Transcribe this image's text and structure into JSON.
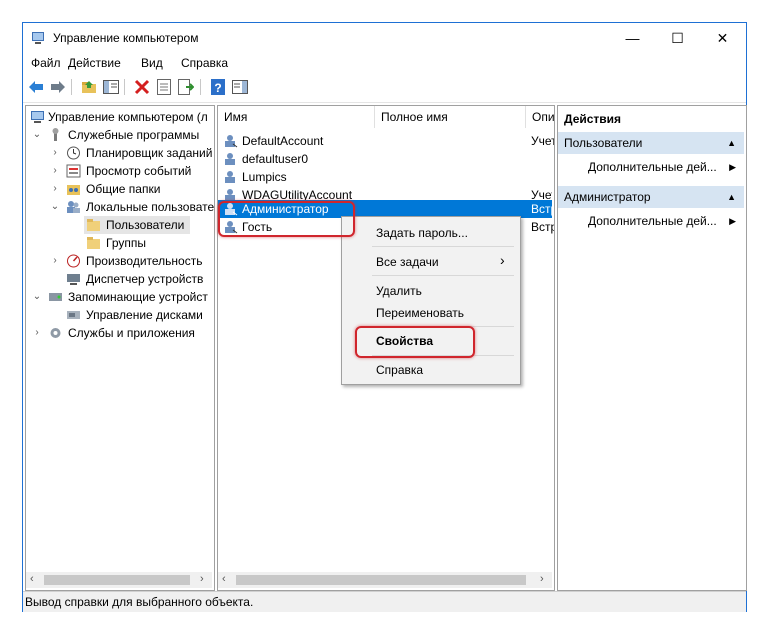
{
  "window": {
    "title": "Управление компьютером"
  },
  "caption": {
    "minimize": "—",
    "maximize": "☐",
    "close": "✕"
  },
  "menu": [
    "Файл",
    "Действие",
    "Вид",
    "Справка"
  ],
  "toolbar": [
    "back-icon",
    "forward-icon",
    "up-folder-icon",
    "show-tree-icon",
    "delete-icon",
    "properties-icon",
    "export-icon",
    "help-icon",
    "action-pane-icon"
  ],
  "tree": {
    "items": [
      {
        "label": "Управление компьютером (л"
      },
      {
        "label": "Служебные программы"
      },
      {
        "label": "Планировщик заданий"
      },
      {
        "label": "Просмотр событий"
      },
      {
        "label": "Общие папки"
      },
      {
        "label": "Локальные пользовате"
      },
      {
        "label": "Пользователи"
      },
      {
        "label": "Группы"
      },
      {
        "label": "Производительность"
      },
      {
        "label": "Диспетчер устройств"
      },
      {
        "label": "Запоминающие устройст"
      },
      {
        "label": "Управление дисками"
      },
      {
        "label": "Службы и приложения"
      }
    ]
  },
  "list": {
    "columns": [
      "Имя",
      "Полное имя",
      "Опи"
    ],
    "rows": [
      {
        "name": "DefaultAccount",
        "desc": "Учет"
      },
      {
        "name": "defaultuser0",
        "desc": ""
      },
      {
        "name": "Lumpics",
        "desc": ""
      },
      {
        "name": "WDAGUtilityAccount",
        "desc": "Учет"
      },
      {
        "name": "Администратор",
        "desc": "Встр"
      },
      {
        "name": "Гость",
        "desc": "Встр"
      }
    ]
  },
  "context_menu": {
    "items": [
      "Задать пароль...",
      "Все задачи",
      "Удалить",
      "Переименовать",
      "Свойства",
      "Справка"
    ],
    "submenu_arrow": "›"
  },
  "actions": {
    "header": "Действия",
    "section1": "Пользователи",
    "item1": "Дополнительные дей...",
    "section2": "Администратор",
    "item2": "Дополнительные дей..."
  },
  "status": "Вывод справки для выбранного объекта.",
  "colors": {
    "selection": "#0078d7",
    "highlight_ring": "#d0262d",
    "accent_border": "#1e70d4"
  }
}
